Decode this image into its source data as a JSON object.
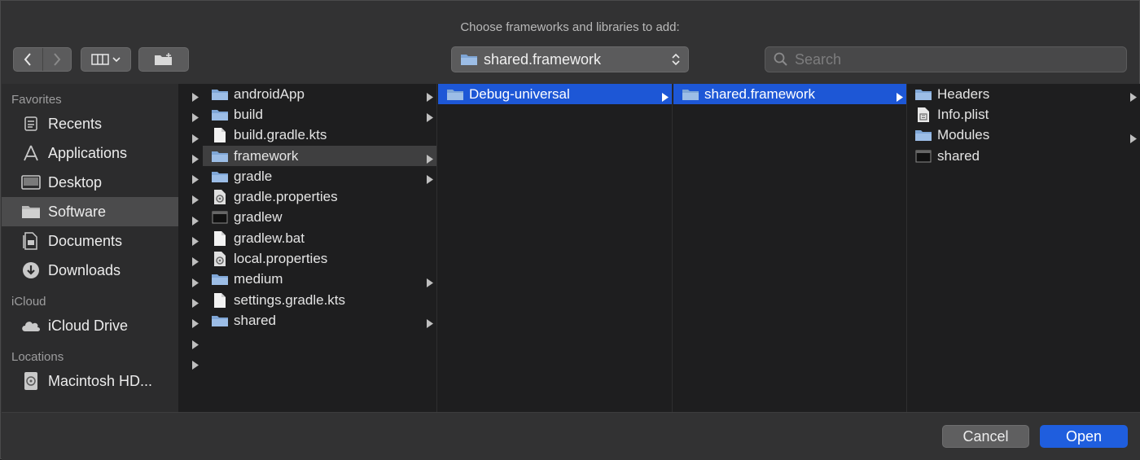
{
  "dialog": {
    "prompt": "Choose frameworks and libraries to add:",
    "path_popup": "shared.framework",
    "search_placeholder": "Search",
    "cancel_label": "Cancel",
    "open_label": "Open",
    "accent_color": "#1d57d6"
  },
  "sidebar": {
    "favorites_header": "Favorites",
    "favorites": [
      {
        "label": "Recents",
        "icon": "recents-icon"
      },
      {
        "label": "Applications",
        "icon": "applications-icon"
      },
      {
        "label": "Desktop",
        "icon": "desktop-icon"
      },
      {
        "label": "Software",
        "icon": "folder-icon",
        "selected": true
      },
      {
        "label": "Documents",
        "icon": "documents-icon"
      },
      {
        "label": "Downloads",
        "icon": "downloads-icon"
      }
    ],
    "icloud_header": "iCloud",
    "icloud": [
      {
        "label": "iCloud Drive",
        "icon": "cloud-icon"
      }
    ],
    "locations_header": "Locations",
    "locations": [
      {
        "label": "Macintosh HD...",
        "icon": "hard-drive-icon"
      }
    ]
  },
  "columns": {
    "col1": [
      {
        "label": "androidApp",
        "type": "folder",
        "has_children": true
      },
      {
        "label": "build",
        "type": "folder",
        "has_children": true
      },
      {
        "label": "build.gradle.kts",
        "type": "file"
      },
      {
        "label": "framework",
        "type": "folder",
        "has_children": true,
        "selected": "inactive"
      },
      {
        "label": "gradle",
        "type": "folder",
        "has_children": true
      },
      {
        "label": "gradle.properties",
        "type": "properties"
      },
      {
        "label": "gradlew",
        "type": "exec"
      },
      {
        "label": "gradlew.bat",
        "type": "file"
      },
      {
        "label": "local.properties",
        "type": "properties"
      },
      {
        "label": "medium",
        "type": "folder",
        "has_children": true
      },
      {
        "label": "settings.gradle.kts",
        "type": "file"
      },
      {
        "label": "shared",
        "type": "folder",
        "has_children": true
      }
    ],
    "col2": [
      {
        "label": "Debug-universal",
        "type": "folder",
        "has_children": true,
        "selected": "active"
      }
    ],
    "col3": [
      {
        "label": "shared.framework",
        "type": "folder",
        "has_children": true,
        "selected": "active"
      }
    ],
    "col4": [
      {
        "label": "Headers",
        "type": "folder",
        "has_children": true
      },
      {
        "label": "Info.plist",
        "type": "plist"
      },
      {
        "label": "Modules",
        "type": "folder",
        "has_children": true
      },
      {
        "label": "shared",
        "type": "exec"
      }
    ]
  }
}
